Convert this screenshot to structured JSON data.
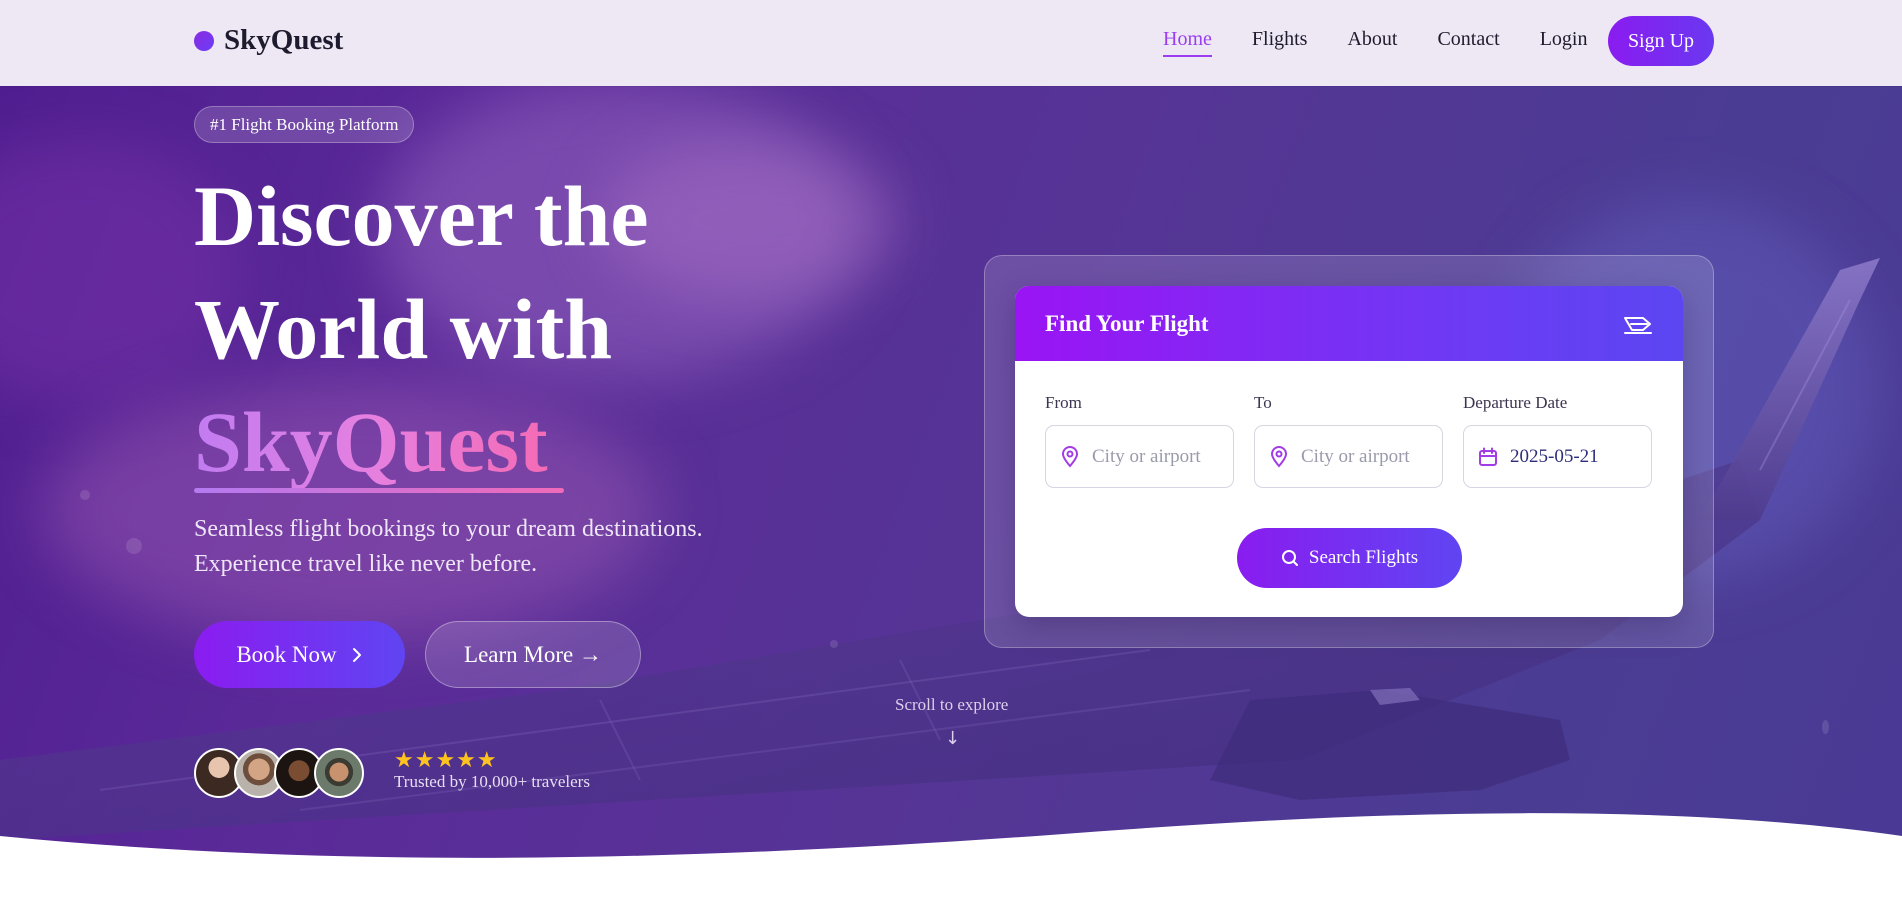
{
  "nav": {
    "logo_text": "SkyQuest",
    "links": [
      {
        "label": "Home",
        "active": true
      },
      {
        "label": "Flights",
        "active": false
      },
      {
        "label": "About",
        "active": false
      },
      {
        "label": "Contact",
        "active": false
      },
      {
        "label": "Login",
        "active": false
      }
    ],
    "signup_label": "Sign Up"
  },
  "hero": {
    "badge": "#1 Flight Booking Platform",
    "headline_line1": "Discover the",
    "headline_line2": "World with",
    "headline_brand": "SkyQuest",
    "subtext_line1": "Seamless flight bookings to your dream destinations.",
    "subtext_line2": "Experience travel like never before.",
    "book_button": "Book Now",
    "learn_button": "Learn More →",
    "stars": "★★★★★",
    "rating": 5,
    "trusted_text": "Trusted by 10,000+ travelers",
    "scroll_hint": "Scroll to explore",
    "scroll_arrow": "↓"
  },
  "search_card": {
    "title": "Find Your Flight",
    "from": {
      "label": "From",
      "placeholder": "City or airport",
      "value": ""
    },
    "to": {
      "label": "To",
      "placeholder": "City or airport",
      "value": ""
    },
    "date": {
      "label": "Departure Date",
      "value": "2025-05-21"
    },
    "search_button": "Search Flights"
  },
  "colors": {
    "accent": "#8a1cf0",
    "accent_secondary": "#5f45f2",
    "brand_gradient_start": "#c17cf1",
    "brand_gradient_end": "#f46bb5",
    "star": "#ffc31f",
    "nav_bg": "#ede8f3"
  },
  "icons": {
    "logo": "circle-dot-icon",
    "card_header": "plane-departure-icon",
    "from": "map-pin-icon",
    "to": "map-pin-icon",
    "date": "calendar-icon",
    "search": "search-icon",
    "book_button": "chevron-right-icon"
  }
}
